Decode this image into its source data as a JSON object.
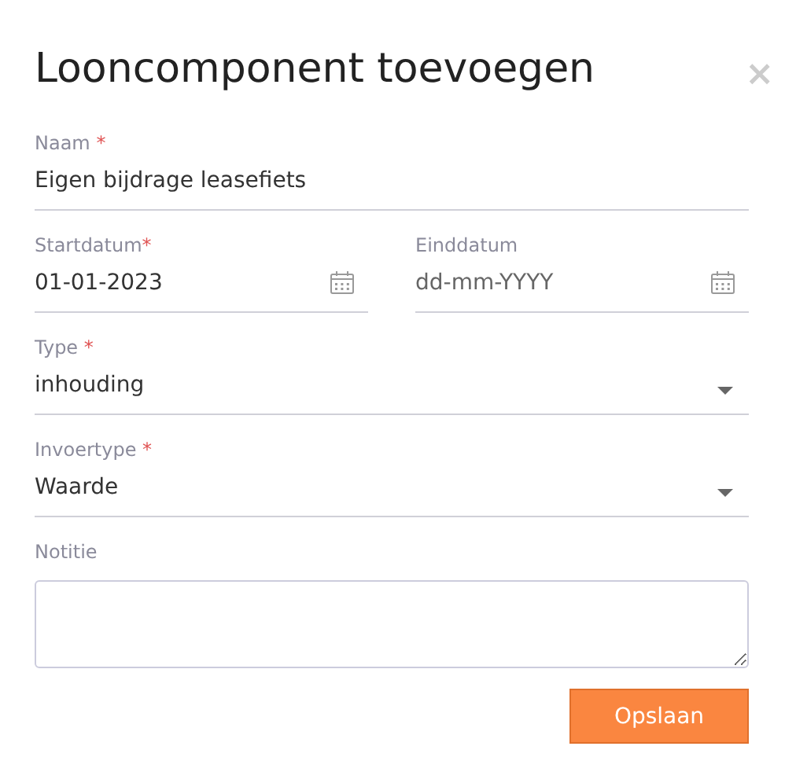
{
  "dialog": {
    "title": "Looncomponent toevoegen",
    "close": "×"
  },
  "rows": [
    {
      "fields": [
        {
          "kind": "text",
          "label": "Naam",
          "mark": " *",
          "value": "Eigen bijdrage leasefiets"
        }
      ]
    },
    {
      "fields": [
        {
          "kind": "date",
          "label": "Startdatum",
          "mark": "*",
          "value": "01-01-2023"
        },
        {
          "kind": "date",
          "label": "Einddatum",
          "placeholder": "dd-mm-YYYY"
        }
      ]
    },
    {
      "fields": [
        {
          "kind": "select",
          "label": "Type",
          "mark": " *",
          "value": "inhouding"
        }
      ]
    },
    {
      "fields": [
        {
          "kind": "select",
          "label": "Invoertype",
          "mark": " *",
          "value": "Waarde"
        }
      ]
    },
    {
      "fields": [
        {
          "kind": "textarea",
          "label": "Notitie"
        }
      ]
    }
  ],
  "buttons": [
    {
      "label": "Opslaan"
    }
  ]
}
